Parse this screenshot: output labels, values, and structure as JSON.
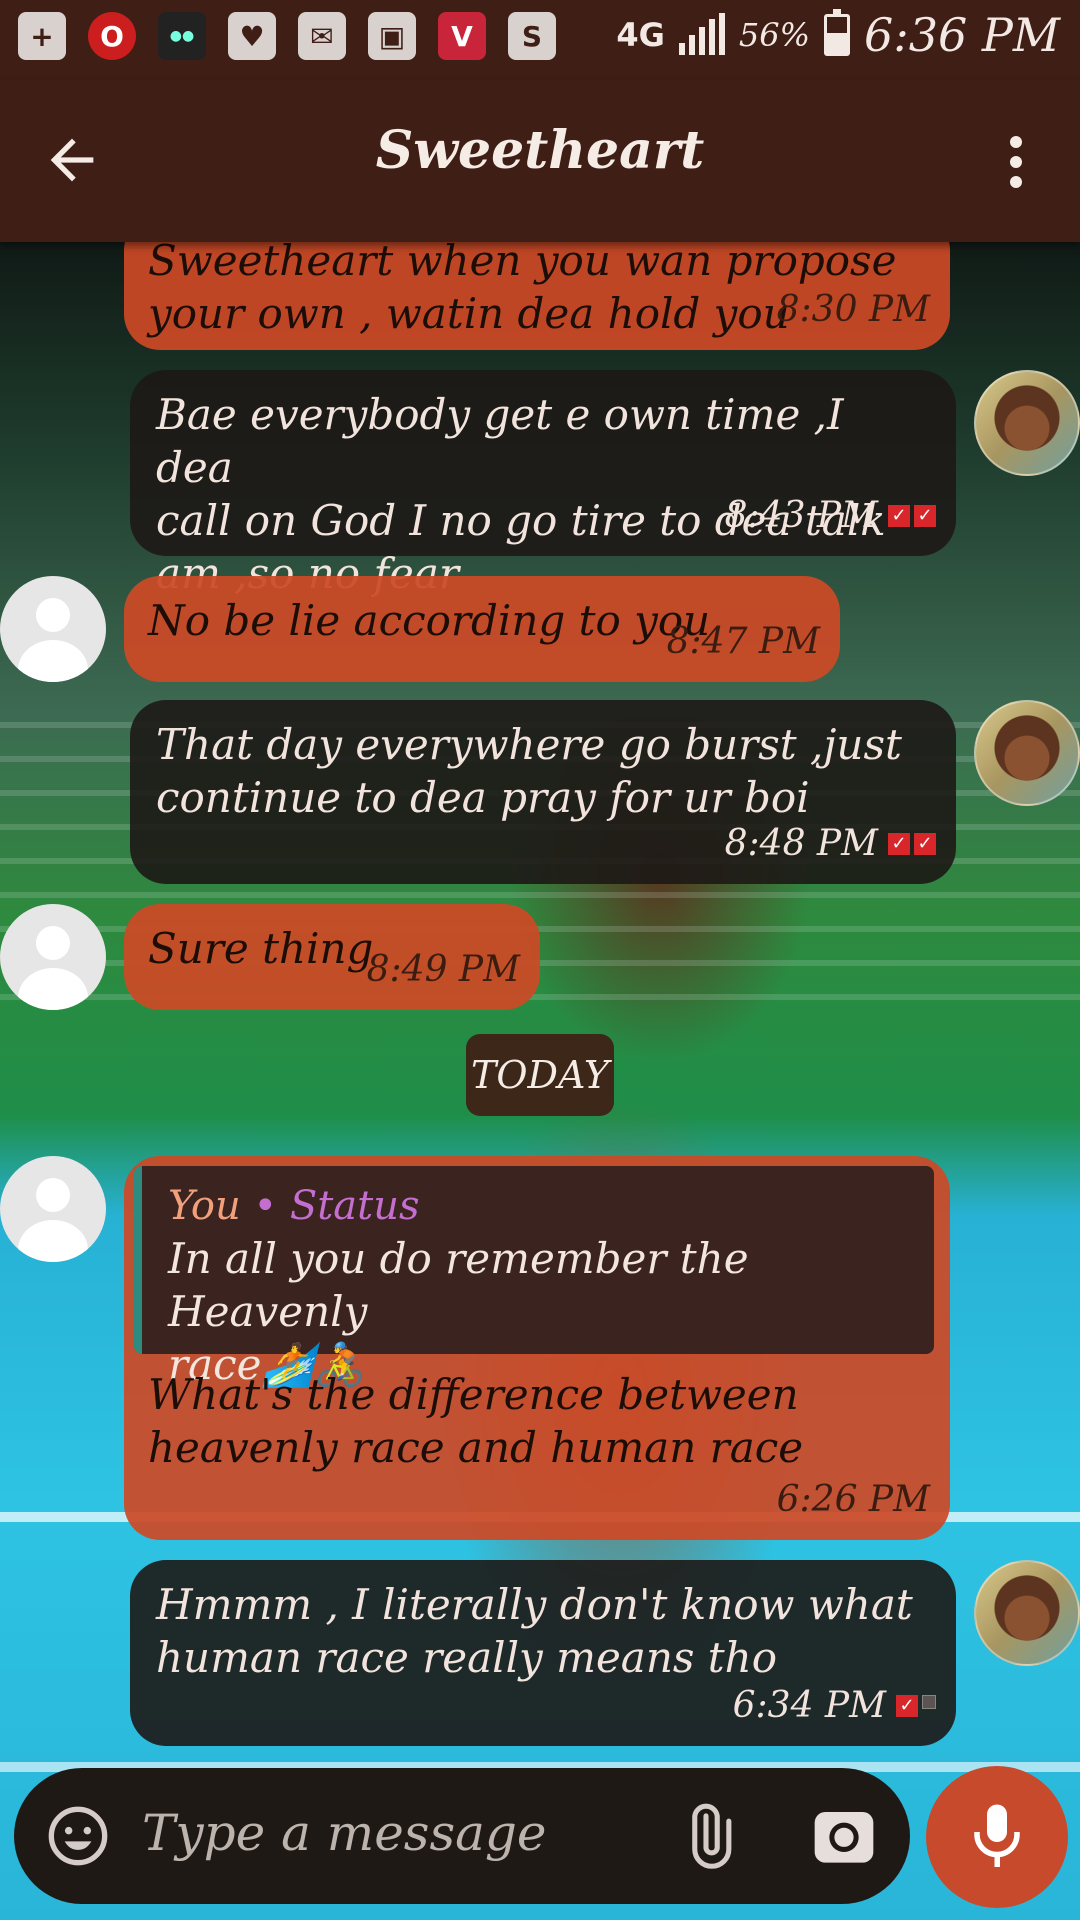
{
  "status_bar": {
    "network": "4G",
    "battery_percent": "56%",
    "battery_level": 0.56,
    "time": "6:36 PM",
    "notification_icons": [
      "plus-icon",
      "opera-mini-icon",
      "multi-app-icon",
      "heart-app-icon",
      "mail-icon",
      "image-icon",
      "vidmate-icon",
      "snapchat-icon"
    ]
  },
  "header": {
    "title": "Sweetheart"
  },
  "messages": [
    {
      "direction": "in",
      "text": "Sweetheart when you wan propose\nyour own , watin dea hold you",
      "time": "8:30 PM"
    },
    {
      "direction": "out",
      "text": "Bae everybody get e own time ,I dea\ncall on God I no go tire to dea talk\nam ,so no fear",
      "time": "8:43 PM",
      "status": "read"
    },
    {
      "direction": "in",
      "text": "No be lie according to you",
      "time": "8:47 PM"
    },
    {
      "direction": "out",
      "text": "That day everywhere go burst ,just\ncontinue to dea pray for ur boi",
      "time": "8:48 PM",
      "status": "read"
    },
    {
      "direction": "in",
      "text": "Sure thing",
      "time": "8:49 PM"
    },
    {
      "direction": "in",
      "quote_sender": "You",
      "quote_separator": "•",
      "quote_label": "Status",
      "quote_text": "In all you do remember the Heavenly\nrace🏄🚴",
      "text": "What's the difference between\nheavenly race and human race",
      "time": "6:26 PM"
    },
    {
      "direction": "out",
      "text": "Hmmm , I literally don't  know what\nhuman race really means tho",
      "time": "6:34 PM",
      "status": "pending"
    }
  ],
  "date_divider": "TODAY",
  "composer": {
    "placeholder": "Type a message"
  },
  "colors": {
    "bar": "#3f1e16",
    "incoming_bubble": "#cc4926",
    "outgoing_bubble": "#1d1816",
    "tick": "#d9262b"
  }
}
